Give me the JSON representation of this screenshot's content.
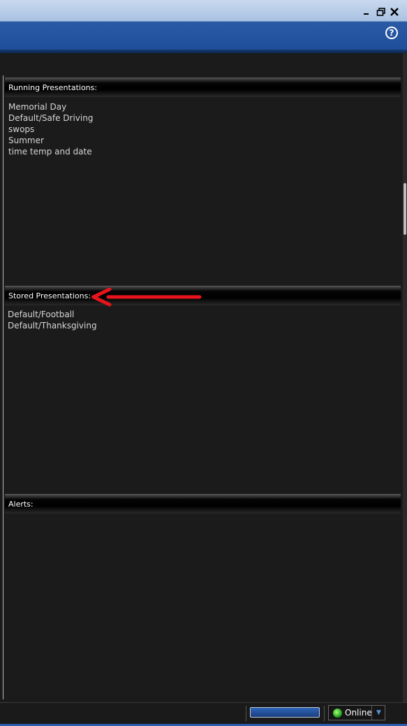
{
  "window": {
    "minimize_icon": "minimize-icon",
    "restore_icon": "restore-icon",
    "close_icon": "close-icon",
    "help_label": "?"
  },
  "running": {
    "header": "Running Presentations:",
    "items": [
      "Memorial Day",
      "Default/Safe Driving",
      "swops",
      "Summer",
      "time temp and date"
    ]
  },
  "stored": {
    "header": "Stored Presentations:",
    "items": [
      "Default/Football",
      "Default/Thanksgiving"
    ]
  },
  "alerts": {
    "header": "Alerts:"
  },
  "status": {
    "connection_label": "Online",
    "dropdown_glyph": "▼",
    "colors": {
      "online": "#26a41f",
      "progress": "#2f66b8"
    }
  },
  "annotation": {
    "arrow_color": "#e8141b"
  }
}
